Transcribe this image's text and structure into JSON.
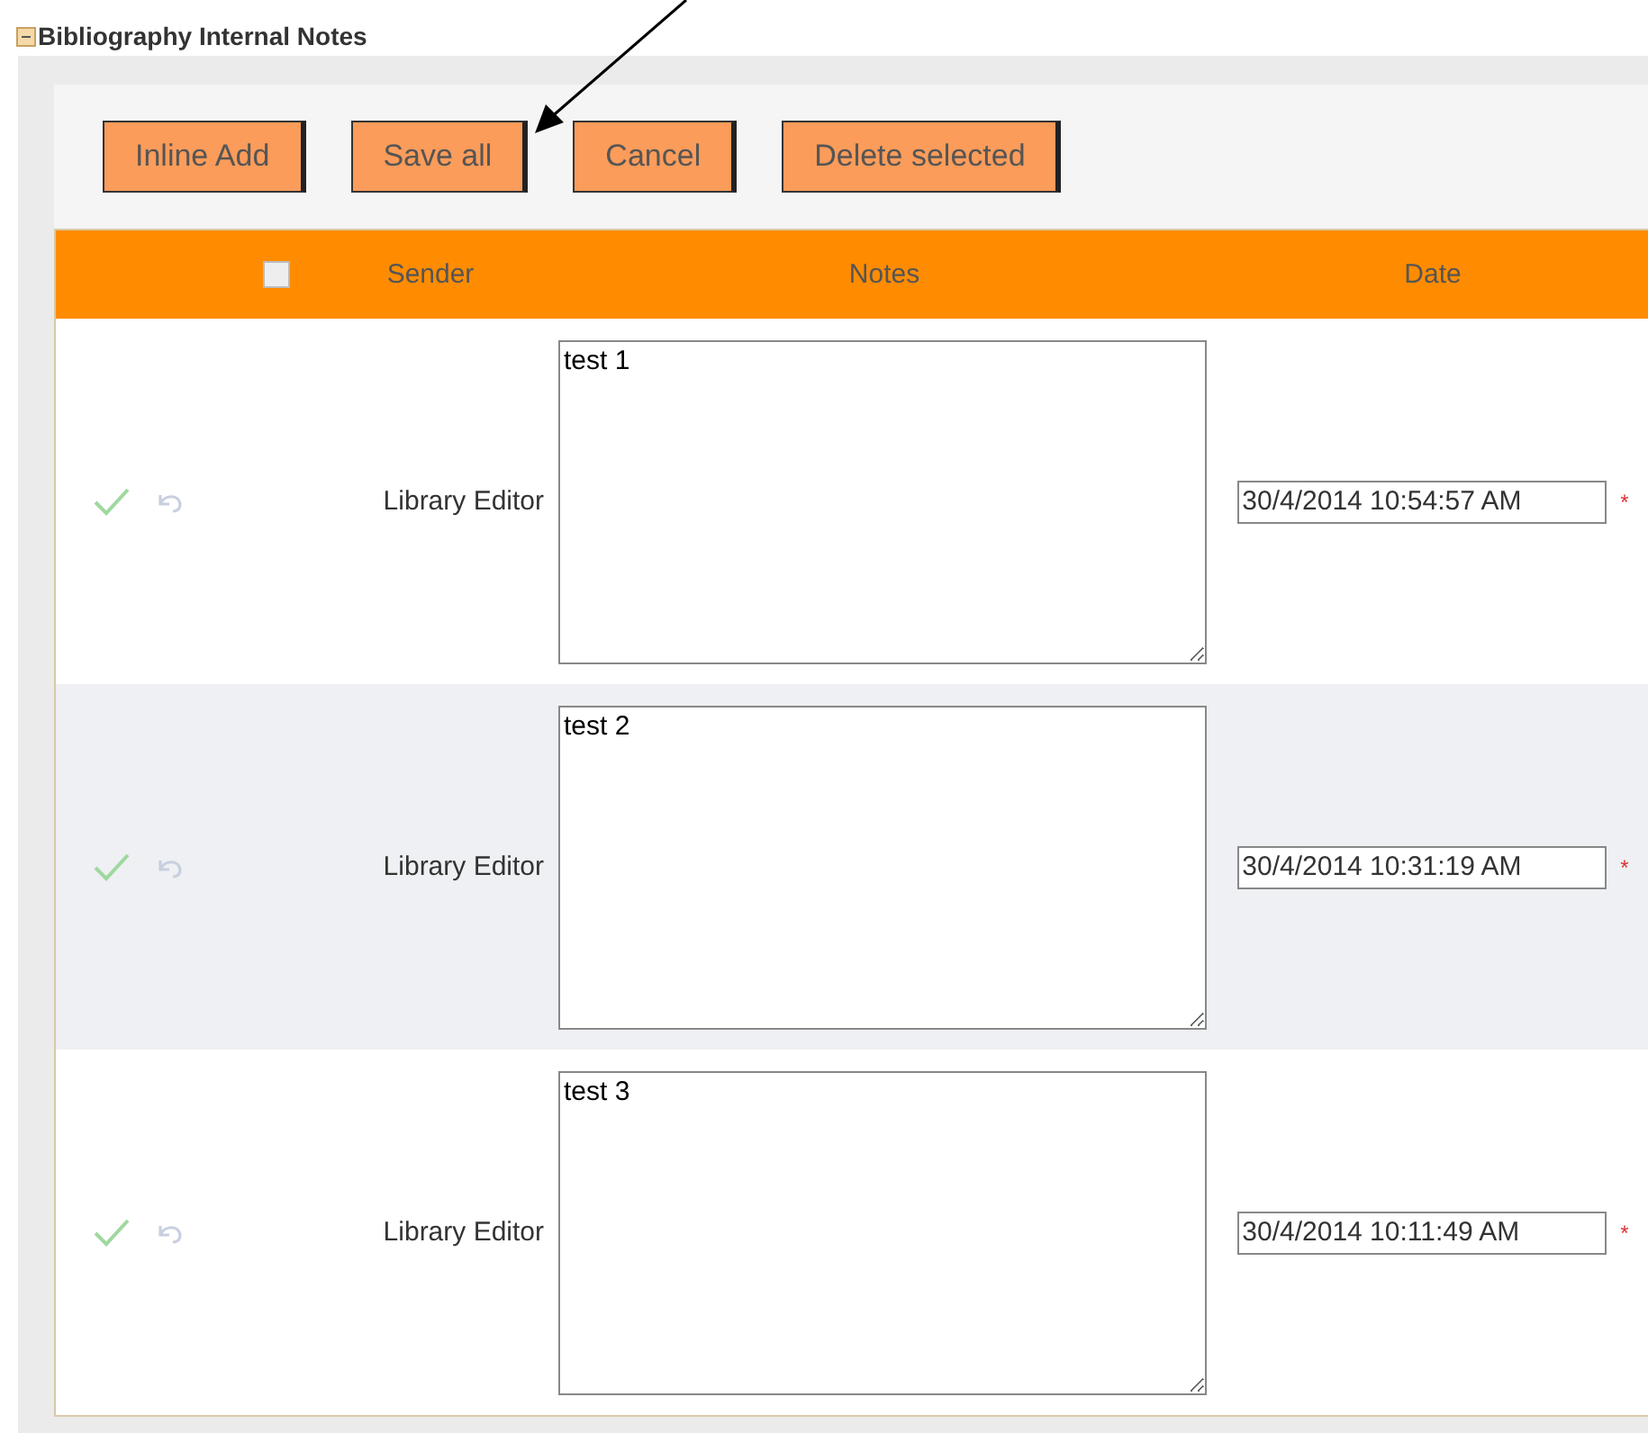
{
  "section": {
    "title": "Bibliography Internal Notes",
    "expanded": true
  },
  "toolbar": {
    "buttons": [
      "Inline Add",
      "Save all",
      "Cancel",
      "Delete selected"
    ]
  },
  "table": {
    "select_all": {
      "checked": false
    },
    "columns": [
      "Sender",
      "Notes",
      "Date"
    ],
    "rows": [
      {
        "sender": "Library Editor",
        "notes": "test 1",
        "date": "30/4/2014 10:54:57 AM",
        "required_mark": "*"
      },
      {
        "sender": "Library Editor",
        "notes": "test 2",
        "date": "30/4/2014 10:31:19 AM",
        "required_mark": "*"
      },
      {
        "sender": "Library Editor",
        "notes": "test 3",
        "date": "30/4/2014 10:11:49 AM",
        "required_mark": "*"
      }
    ]
  }
}
